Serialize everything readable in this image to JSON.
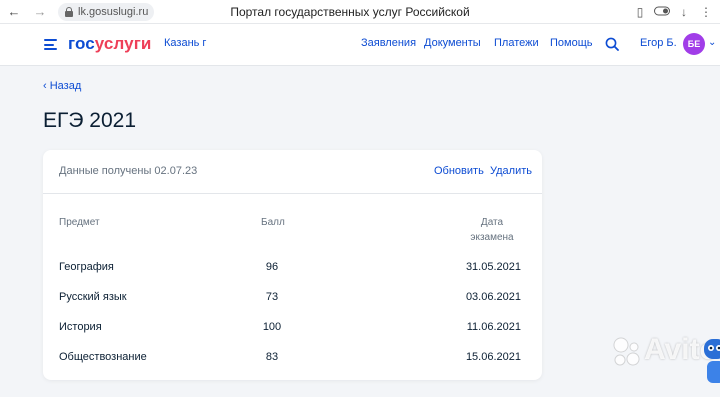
{
  "browser": {
    "url": "lk.gosuslugi.ru",
    "title": "Портал государственных услуг Российской Федерации"
  },
  "header": {
    "logo_part1": "гос",
    "logo_part2": "услуги",
    "city": "Казань г",
    "nav": [
      "Заявления",
      "Документы",
      "Платежи",
      "Помощь"
    ],
    "user_name": "Егор Б.",
    "avatar_initials": "БЕ",
    "accent_color": "#0d4cd3",
    "logo_accent_color": "#ee3f58",
    "avatar_color": "#a13de8"
  },
  "page": {
    "back_label": "Назад",
    "title": "ЕГЭ 2021"
  },
  "card": {
    "received": "Данные получены 02.07.23",
    "refresh_label": "Обновить",
    "delete_label": "Удалить",
    "columns": {
      "subject": "Предмет",
      "score": "Балл",
      "date_line1": "Дата",
      "date_line2": "экзамена"
    },
    "rows": [
      {
        "subject": "География",
        "score": "96",
        "date": "31.05.2021"
      },
      {
        "subject": "Русский язык",
        "score": "73",
        "date": "03.06.2021"
      },
      {
        "subject": "История",
        "score": "100",
        "date": "11.06.2021"
      },
      {
        "subject": "Обществознание",
        "score": "83",
        "date": "15.06.2021"
      }
    ]
  },
  "watermark": {
    "text": "Avito"
  }
}
